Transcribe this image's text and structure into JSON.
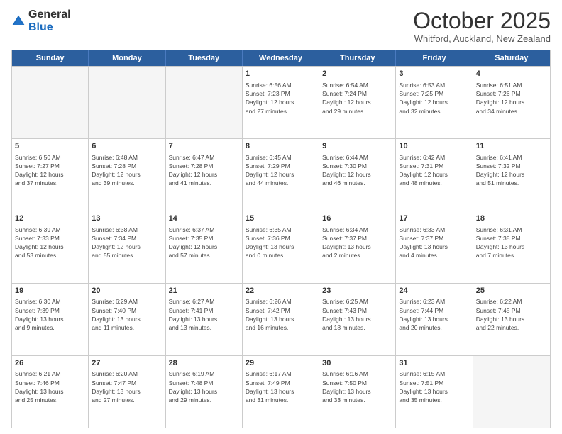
{
  "header": {
    "logo_general": "General",
    "logo_blue": "Blue",
    "month": "October 2025",
    "location": "Whitford, Auckland, New Zealand"
  },
  "days_of_week": [
    "Sunday",
    "Monday",
    "Tuesday",
    "Wednesday",
    "Thursday",
    "Friday",
    "Saturday"
  ],
  "weeks": [
    [
      {
        "day": "",
        "empty": true
      },
      {
        "day": "",
        "empty": true
      },
      {
        "day": "",
        "empty": true
      },
      {
        "day": "1",
        "lines": [
          "Sunrise: 6:56 AM",
          "Sunset: 7:23 PM",
          "Daylight: 12 hours",
          "and 27 minutes."
        ]
      },
      {
        "day": "2",
        "lines": [
          "Sunrise: 6:54 AM",
          "Sunset: 7:24 PM",
          "Daylight: 12 hours",
          "and 29 minutes."
        ]
      },
      {
        "day": "3",
        "lines": [
          "Sunrise: 6:53 AM",
          "Sunset: 7:25 PM",
          "Daylight: 12 hours",
          "and 32 minutes."
        ]
      },
      {
        "day": "4",
        "lines": [
          "Sunrise: 6:51 AM",
          "Sunset: 7:26 PM",
          "Daylight: 12 hours",
          "and 34 minutes."
        ]
      }
    ],
    [
      {
        "day": "5",
        "lines": [
          "Sunrise: 6:50 AM",
          "Sunset: 7:27 PM",
          "Daylight: 12 hours",
          "and 37 minutes."
        ]
      },
      {
        "day": "6",
        "lines": [
          "Sunrise: 6:48 AM",
          "Sunset: 7:28 PM",
          "Daylight: 12 hours",
          "and 39 minutes."
        ]
      },
      {
        "day": "7",
        "lines": [
          "Sunrise: 6:47 AM",
          "Sunset: 7:28 PM",
          "Daylight: 12 hours",
          "and 41 minutes."
        ]
      },
      {
        "day": "8",
        "lines": [
          "Sunrise: 6:45 AM",
          "Sunset: 7:29 PM",
          "Daylight: 12 hours",
          "and 44 minutes."
        ]
      },
      {
        "day": "9",
        "lines": [
          "Sunrise: 6:44 AM",
          "Sunset: 7:30 PM",
          "Daylight: 12 hours",
          "and 46 minutes."
        ]
      },
      {
        "day": "10",
        "lines": [
          "Sunrise: 6:42 AM",
          "Sunset: 7:31 PM",
          "Daylight: 12 hours",
          "and 48 minutes."
        ]
      },
      {
        "day": "11",
        "lines": [
          "Sunrise: 6:41 AM",
          "Sunset: 7:32 PM",
          "Daylight: 12 hours",
          "and 51 minutes."
        ]
      }
    ],
    [
      {
        "day": "12",
        "lines": [
          "Sunrise: 6:39 AM",
          "Sunset: 7:33 PM",
          "Daylight: 12 hours",
          "and 53 minutes."
        ]
      },
      {
        "day": "13",
        "lines": [
          "Sunrise: 6:38 AM",
          "Sunset: 7:34 PM",
          "Daylight: 12 hours",
          "and 55 minutes."
        ]
      },
      {
        "day": "14",
        "lines": [
          "Sunrise: 6:37 AM",
          "Sunset: 7:35 PM",
          "Daylight: 12 hours",
          "and 57 minutes."
        ]
      },
      {
        "day": "15",
        "lines": [
          "Sunrise: 6:35 AM",
          "Sunset: 7:36 PM",
          "Daylight: 13 hours",
          "and 0 minutes."
        ]
      },
      {
        "day": "16",
        "lines": [
          "Sunrise: 6:34 AM",
          "Sunset: 7:37 PM",
          "Daylight: 13 hours",
          "and 2 minutes."
        ]
      },
      {
        "day": "17",
        "lines": [
          "Sunrise: 6:33 AM",
          "Sunset: 7:37 PM",
          "Daylight: 13 hours",
          "and 4 minutes."
        ]
      },
      {
        "day": "18",
        "lines": [
          "Sunrise: 6:31 AM",
          "Sunset: 7:38 PM",
          "Daylight: 13 hours",
          "and 7 minutes."
        ]
      }
    ],
    [
      {
        "day": "19",
        "lines": [
          "Sunrise: 6:30 AM",
          "Sunset: 7:39 PM",
          "Daylight: 13 hours",
          "and 9 minutes."
        ]
      },
      {
        "day": "20",
        "lines": [
          "Sunrise: 6:29 AM",
          "Sunset: 7:40 PM",
          "Daylight: 13 hours",
          "and 11 minutes."
        ]
      },
      {
        "day": "21",
        "lines": [
          "Sunrise: 6:27 AM",
          "Sunset: 7:41 PM",
          "Daylight: 13 hours",
          "and 13 minutes."
        ]
      },
      {
        "day": "22",
        "lines": [
          "Sunrise: 6:26 AM",
          "Sunset: 7:42 PM",
          "Daylight: 13 hours",
          "and 16 minutes."
        ]
      },
      {
        "day": "23",
        "lines": [
          "Sunrise: 6:25 AM",
          "Sunset: 7:43 PM",
          "Daylight: 13 hours",
          "and 18 minutes."
        ]
      },
      {
        "day": "24",
        "lines": [
          "Sunrise: 6:23 AM",
          "Sunset: 7:44 PM",
          "Daylight: 13 hours",
          "and 20 minutes."
        ]
      },
      {
        "day": "25",
        "lines": [
          "Sunrise: 6:22 AM",
          "Sunset: 7:45 PM",
          "Daylight: 13 hours",
          "and 22 minutes."
        ]
      }
    ],
    [
      {
        "day": "26",
        "lines": [
          "Sunrise: 6:21 AM",
          "Sunset: 7:46 PM",
          "Daylight: 13 hours",
          "and 25 minutes."
        ]
      },
      {
        "day": "27",
        "lines": [
          "Sunrise: 6:20 AM",
          "Sunset: 7:47 PM",
          "Daylight: 13 hours",
          "and 27 minutes."
        ]
      },
      {
        "day": "28",
        "lines": [
          "Sunrise: 6:19 AM",
          "Sunset: 7:48 PM",
          "Daylight: 13 hours",
          "and 29 minutes."
        ]
      },
      {
        "day": "29",
        "lines": [
          "Sunrise: 6:17 AM",
          "Sunset: 7:49 PM",
          "Daylight: 13 hours",
          "and 31 minutes."
        ]
      },
      {
        "day": "30",
        "lines": [
          "Sunrise: 6:16 AM",
          "Sunset: 7:50 PM",
          "Daylight: 13 hours",
          "and 33 minutes."
        ]
      },
      {
        "day": "31",
        "lines": [
          "Sunrise: 6:15 AM",
          "Sunset: 7:51 PM",
          "Daylight: 13 hours",
          "and 35 minutes."
        ]
      },
      {
        "day": "",
        "empty": true
      }
    ]
  ]
}
